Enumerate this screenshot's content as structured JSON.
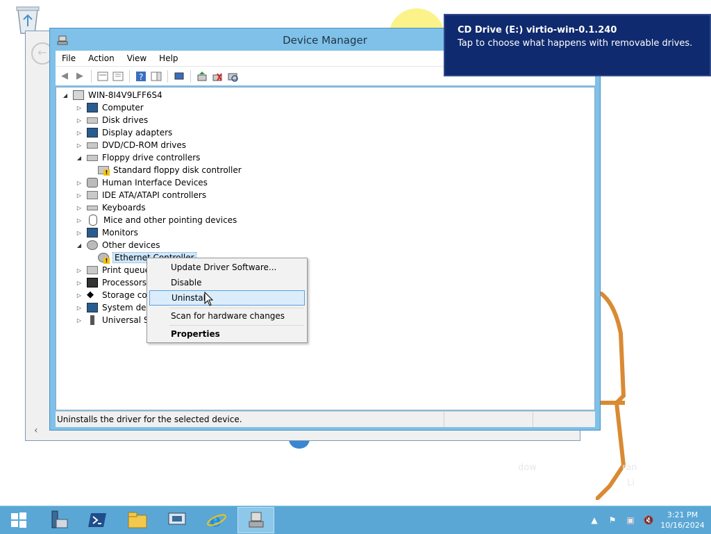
{
  "desktop": {
    "recycle_bin": "recycle-bin-icon",
    "watermark_fragments": [
      "dow",
      "ran",
      "Li"
    ]
  },
  "window": {
    "title": "Device Manager",
    "menu": [
      "File",
      "Action",
      "View",
      "Help"
    ],
    "toolbar_icons": [
      "back-icon",
      "forward-icon",
      "properties-icon",
      "console-tree-icon",
      "help-icon",
      "action-pane-icon",
      "show-device-icon",
      "update-driver-icon",
      "uninstall-icon",
      "scan-hardware-icon"
    ]
  },
  "tree": {
    "root": "WIN-8I4V9LFF6S4",
    "items": [
      {
        "label": "Computer",
        "expanded": false
      },
      {
        "label": "Disk drives",
        "expanded": false
      },
      {
        "label": "Display adapters",
        "expanded": false
      },
      {
        "label": "DVD/CD-ROM drives",
        "expanded": false
      },
      {
        "label": "Floppy drive controllers",
        "expanded": true
      },
      {
        "label": "Standard floppy disk controller",
        "child": true
      },
      {
        "label": "Human Interface Devices",
        "expanded": false
      },
      {
        "label": "IDE ATA/ATAPI controllers",
        "expanded": false
      },
      {
        "label": "Keyboards",
        "expanded": false
      },
      {
        "label": "Mice and other pointing devices",
        "expanded": false
      },
      {
        "label": "Monitors",
        "expanded": false
      },
      {
        "label": "Other devices",
        "expanded": true
      },
      {
        "label": "Ethernet Controller",
        "child": true,
        "selected": true,
        "warning": true
      },
      {
        "label": "Print queues",
        "expanded": false
      },
      {
        "label": "Processors",
        "expanded": false
      },
      {
        "label": "Storage cont",
        "expanded": false
      },
      {
        "label": "System devic",
        "expanded": false
      },
      {
        "label": "Universal Ser",
        "expanded": false
      }
    ]
  },
  "context_menu": {
    "items": [
      {
        "label": "Update Driver Software..."
      },
      {
        "label": "Disable"
      },
      {
        "label": "Uninstall",
        "highlighted": true
      },
      {
        "label": "Scan for hardware changes"
      },
      {
        "label": "Properties",
        "bold": true
      }
    ]
  },
  "status": {
    "text": "Uninstalls the driver for the selected device."
  },
  "toast": {
    "title": "CD Drive (E:) virtio-win-0.1.240",
    "body": "Tap to choose what happens with removable drives."
  },
  "taskbar": {
    "buttons": [
      "start-icon",
      "server-manager-icon",
      "powershell-icon",
      "file-explorer-icon",
      "network-icon",
      "internet-explorer-icon",
      "device-manager-icon"
    ],
    "clock_time": "3:21 PM",
    "clock_date": "10/16/2024"
  },
  "colors": {
    "accent": "#7fc1e8",
    "toast_bg": "#0f2a6e",
    "taskbar": "#5aa7d6",
    "menu_highlight": "#dbecfb"
  }
}
